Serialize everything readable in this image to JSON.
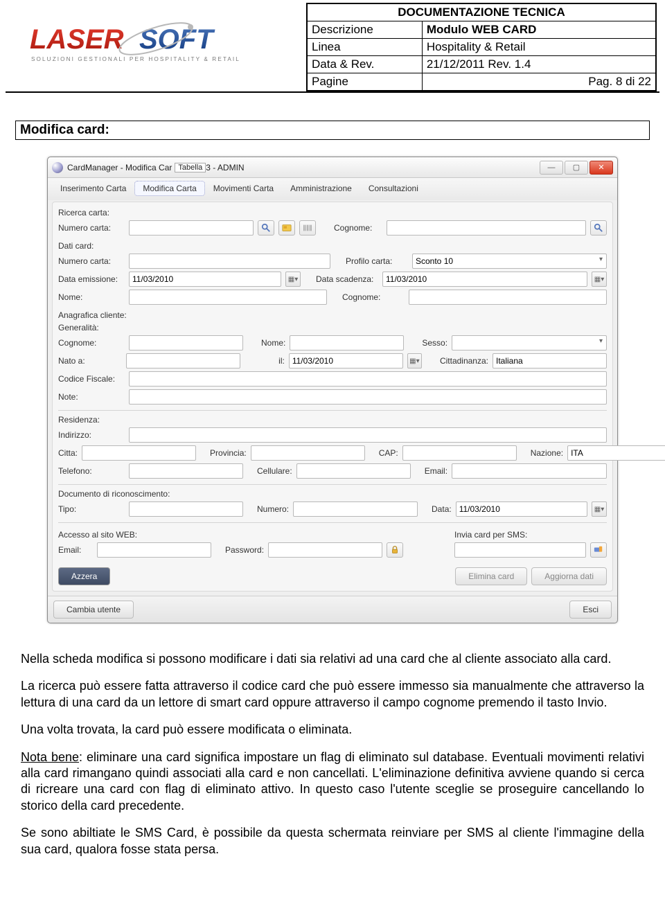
{
  "header": {
    "title": "DOCUMENTAZIONE TECNICA",
    "rows": {
      "descrizione_label": "Descrizione",
      "descrizione_value": "Modulo WEB CARD",
      "linea_label": "Linea",
      "linea_value": "Hospitality & Retail",
      "data_label": "Data & Rev.",
      "data_value": "21/12/2011  Rev. 1.4",
      "pagine_label": "Pagine",
      "pagine_value": "Pag. 8 di  22"
    }
  },
  "logo": {
    "brand_left": "LASER",
    "brand_right": "SOFT",
    "tagline": "SOLUZIONI GESTIONALI PER HOSPITALITY & RETAIL"
  },
  "section_title": "Modifica card:",
  "window": {
    "title_prefix": "CardManager - Modifica Car",
    "title_tag": "Tabella",
    "title_suffix": "3 - ADMIN",
    "menu": [
      "Inserimento Carta",
      "Modifica Carta",
      "Movimenti Carta",
      "Amministrazione",
      "Consultazioni"
    ],
    "menu_active_index": 1,
    "groups": {
      "ricerca": {
        "title": "Ricerca carta:",
        "numero_label": "Numero carta:",
        "cognome_label": "Cognome:"
      },
      "dati": {
        "title": "Dati card:",
        "numero_label": "Numero carta:",
        "profilo_label": "Profilo carta:",
        "profilo_value": "Sconto 10",
        "data_em_label": "Data emissione:",
        "data_em_value": "11/03/2010",
        "data_sc_label": "Data scadenza:",
        "data_sc_value": "11/03/2010",
        "nome_label": "Nome:",
        "cognome_label": "Cognome:"
      },
      "anagrafica": {
        "title": "Anagrafica cliente:",
        "generalita": "Generalità:",
        "cognome_label": "Cognome:",
        "nome_label": "Nome:",
        "sesso_label": "Sesso:",
        "nato_label": "Nato a:",
        "il_label": "il:",
        "il_value": "11/03/2010",
        "citt_label": "Cittadinanza:",
        "citt_value": "Italiana",
        "cf_label": "Codice Fiscale:",
        "note_label": "Note:"
      },
      "residenza": {
        "title": "Residenza:",
        "indirizzo_label": "Indirizzo:",
        "citta_label": "Citta:",
        "provincia_label": "Provincia:",
        "cap_label": "CAP:",
        "nazione_label": "Nazione:",
        "nazione_value": "ITA",
        "telefono_label": "Telefono:",
        "cellulare_label": "Cellulare:",
        "email_label": "Email:"
      },
      "documento": {
        "title": "Documento di riconoscimento:",
        "tipo_label": "Tipo:",
        "numero_label": "Numero:",
        "data_label": "Data:",
        "data_value": "11/03/2010"
      },
      "web": {
        "title": "Accesso al sito WEB:",
        "email_label": "Email:",
        "password_label": "Password:"
      },
      "sms": {
        "title": "Invia card per SMS:"
      }
    },
    "buttons": {
      "azzera": "Azzera",
      "elimina": "Elimina card",
      "aggiorna": "Aggiorna dati",
      "cambia": "Cambia utente",
      "esci": "Esci"
    }
  },
  "body": {
    "p1": "Nella scheda modifica si possono modificare i dati sia relativi ad una card che al cliente associato alla card.",
    "p2": "La ricerca può essere fatta attraverso il codice card che può essere immesso sia manualmente che attraverso la lettura di una card da un lettore di smart card  oppure attraverso il campo cognome premendo il tasto Invio.",
    "p3": "Una volta trovata, la card può essere modificata o eliminata.",
    "p4a": "Nota bene",
    "p4b": ": eliminare una card significa impostare un flag di eliminato sul database. Eventuali movimenti relativi alla card rimangano quindi associati alla card e non cancellati. L'eliminazione definitiva avviene quando si cerca di ricreare una card con flag di eliminato attivo. In questo caso l'utente sceglie se proseguire cancellando lo storico della card precedente.",
    "p5": "Se sono abiltiate le SMS Card, è possibile da questa schermata reinviare per SMS al cliente l'immagine della sua card, qualora fosse stata persa."
  }
}
